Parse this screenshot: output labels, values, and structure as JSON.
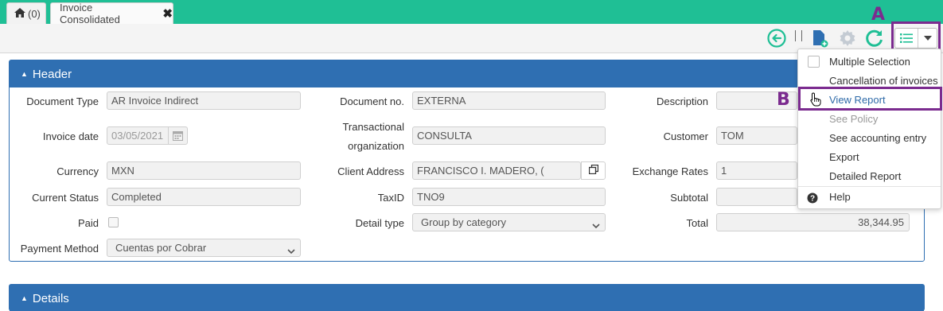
{
  "tabs": {
    "home_count": "(0)",
    "invoice_label": "Invoice Consolidated",
    "close_symbol": "✖"
  },
  "annotations": {
    "marker_a": "A",
    "marker_b": "B",
    "color": "#7b2b8f"
  },
  "header_panel": {
    "title": "Header",
    "fields": {
      "document_type": {
        "label": "Document Type",
        "value": "AR Invoice Indirect"
      },
      "document_no": {
        "label": "Document no.",
        "value": "EXTERNA"
      },
      "description": {
        "label": "Description",
        "value": ""
      },
      "invoice_date": {
        "label": "Invoice date",
        "value": "03/05/2021"
      },
      "transactional_org": {
        "label_line1": "Transactional",
        "label_line2": "organization",
        "value": "CONSULTA"
      },
      "customer": {
        "label": "Customer",
        "value": "TOM"
      },
      "currency": {
        "label": "Currency",
        "value": "MXN"
      },
      "client_address": {
        "label": "Client Address",
        "value": "FRANCISCO I. MADERO, ("
      },
      "exchange_rates": {
        "label": "Exchange Rates",
        "value": "1"
      },
      "current_status": {
        "label": "Current Status",
        "value": "Completed"
      },
      "taxid": {
        "label": "TaxID",
        "value": "TNO9"
      },
      "subtotal": {
        "label": "Subtotal",
        "value": ""
      },
      "paid": {
        "label": "Paid"
      },
      "detail_type": {
        "label": "Detail type",
        "value": "Group by category"
      },
      "total": {
        "label": "Total",
        "value": "38,344.95"
      },
      "payment_method": {
        "label": "Payment Method",
        "value": "Cuentas por Cobrar"
      }
    }
  },
  "details_panel": {
    "title": "Details"
  },
  "menu": {
    "items": [
      {
        "label": "Multiple Selection"
      },
      {
        "label": "Cancellation of invoices"
      },
      {
        "label": "View Report"
      },
      {
        "label": "See Policy"
      },
      {
        "label": "See accounting entry"
      },
      {
        "label": "Export"
      },
      {
        "label": "Detailed Report"
      },
      {
        "label": "Help"
      }
    ]
  },
  "colors": {
    "tabbar": "#1fbf95",
    "panel": "#2f6fb2",
    "accent_green": "#1fbf95",
    "doc_blue": "#2f6fb2"
  }
}
